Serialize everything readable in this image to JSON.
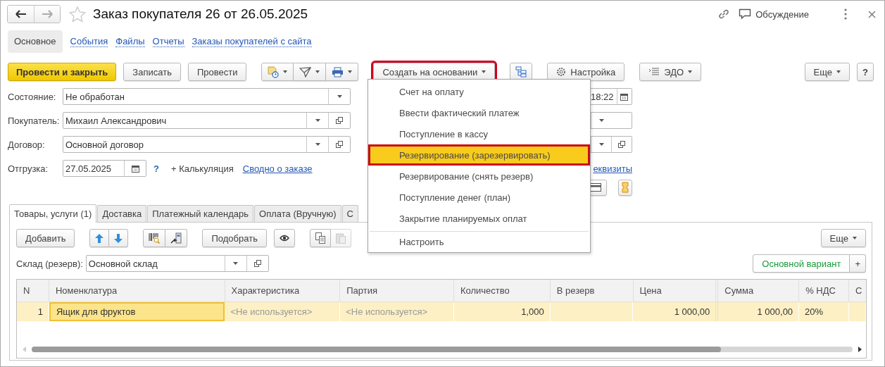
{
  "window": {
    "title": "Заказ покупателя 26 от 26.05.2025",
    "discussion": "Обсуждение"
  },
  "nav_tabs": [
    {
      "label": "Основное",
      "selected": true
    },
    {
      "label": "События",
      "selected": false
    },
    {
      "label": "Файлы",
      "selected": false
    },
    {
      "label": "Отчеты",
      "selected": false
    },
    {
      "label": "Заказы покупателей с сайта",
      "selected": false
    }
  ],
  "toolbar": {
    "post_and_close": "Провести и закрыть",
    "save": "Записать",
    "post": "Провести",
    "create_based_on": {
      "label": "Создать на основании",
      "highlighted": true,
      "expanded": true
    },
    "settings": "Настройка",
    "edo": "ЭДО",
    "more": "Еще",
    "help": "?"
  },
  "fields": [
    {
      "label": "Состояние:",
      "value": "Не обработан",
      "kind": "select"
    },
    {
      "label": "Покупатель:",
      "value": "Михаил Александрович",
      "kind": "select_open"
    },
    {
      "label": "Договор:",
      "value": "Основной договор",
      "kind": "select_open"
    },
    {
      "label": "Отгрузка:",
      "value": "27.05.2025",
      "kind": "date"
    }
  ],
  "shipment_extras": {
    "help": "?",
    "calculation": "+ Калькуляция",
    "summary_link": "Сводно о заказе"
  },
  "right_fields": [
    {
      "value": "18:22",
      "kind": "date"
    },
    {
      "kind": "select"
    },
    {
      "kind": "select_open"
    }
  ],
  "requisites_link": "еквизиты",
  "doc_tabs": [
    {
      "label": "Товары, услуги (1)",
      "selected": true
    },
    {
      "label": "Доставка",
      "selected": false
    },
    {
      "label": "Платежный календарь",
      "selected": false
    },
    {
      "label": "Оплата (Вручную)",
      "selected": false
    },
    {
      "label": "С",
      "selected": false
    }
  ],
  "table_toolbar": {
    "add": "Добавить",
    "pick": "Подобрать",
    "more": "Еще",
    "paste_enabled": false
  },
  "warehouse": {
    "label": "Склад (резерв):",
    "value": "Основной склад"
  },
  "variant": {
    "label": "Основной вариант",
    "add": "+"
  },
  "table": {
    "columns": [
      "N",
      "Номенклатура",
      "Характеристика",
      "Партия",
      "Количество",
      "В резерв",
      "Цена",
      "Сумма",
      "% НДС",
      "С"
    ],
    "rows": [
      {
        "selected": true,
        "n": "1",
        "item": {
          "text": "Ящик для фруктов",
          "focused": true
        },
        "characteristic": "<Не используется>",
        "batch": "<Не используется>",
        "quantity": "1,000",
        "price": "1 000,00",
        "sum": "1 000,00",
        "vat": "20%"
      }
    ]
  },
  "menu": {
    "items": [
      {
        "label": "Счет на оплату",
        "selected": false,
        "highlighted": false,
        "separator_before": false
      },
      {
        "label": "Ввести фактический платеж",
        "selected": false,
        "highlighted": false,
        "separator_before": false
      },
      {
        "label": "Поступление в кассу",
        "selected": false,
        "highlighted": false,
        "separator_before": false
      },
      {
        "label": "Резервирование (зарезервировать)",
        "selected": true,
        "highlighted": true,
        "separator_before": false
      },
      {
        "label": "Резервирование (снять резерв)",
        "selected": false,
        "highlighted": false,
        "separator_before": false
      },
      {
        "label": "Поступление денег (план)",
        "selected": false,
        "highlighted": false,
        "separator_before": false
      },
      {
        "label": "Закрытие планируемых оплат",
        "selected": false,
        "highlighted": false,
        "separator_before": false
      },
      {
        "label": "Настроить",
        "selected": false,
        "highlighted": false,
        "separator_before": true
      }
    ]
  }
}
